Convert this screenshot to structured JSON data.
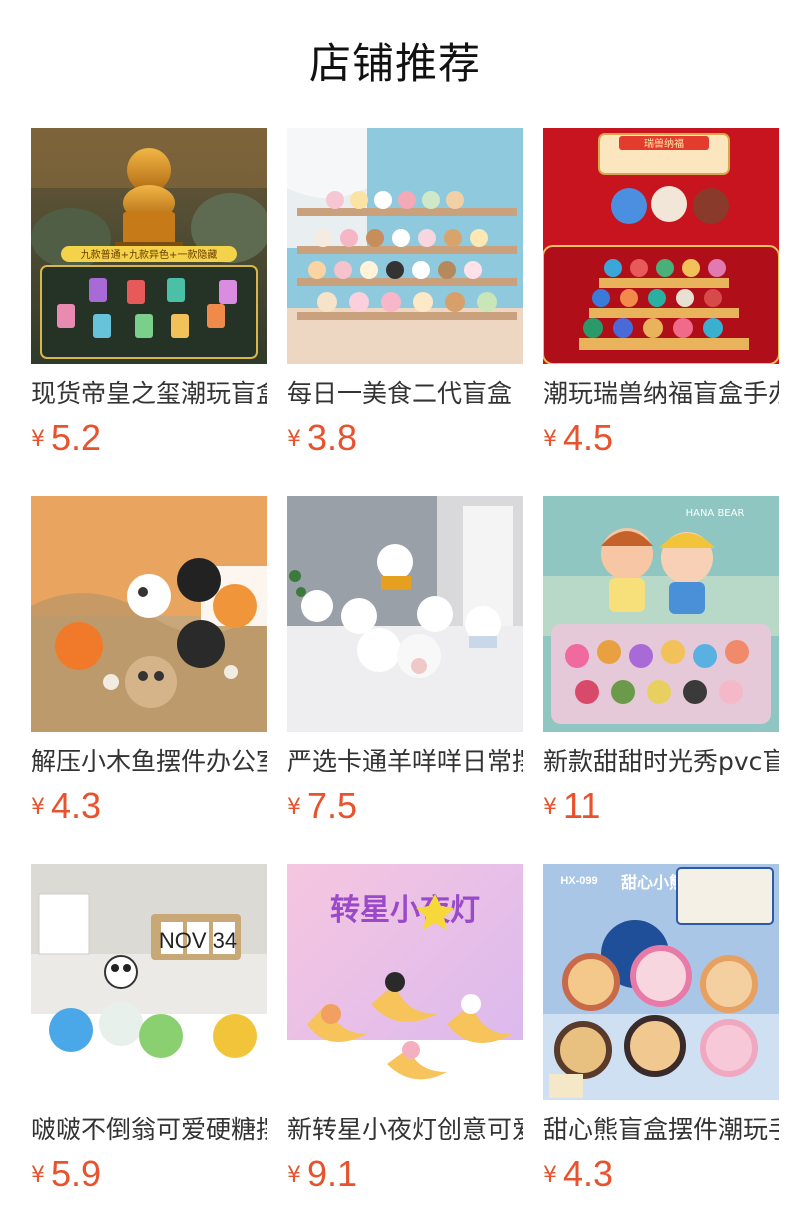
{
  "page": {
    "title": "店铺推荐"
  },
  "currency_symbol": "¥",
  "products": [
    {
      "name": "现货帝皇之玺潮玩盲盒",
      "price": "5.2",
      "image": "dragon-seal-figure",
      "banner_text": "九款普通+九款异色+一款隐藏"
    },
    {
      "name": "每日一美食二代盲盒",
      "price": "3.8",
      "image": "food-figures-shelf"
    },
    {
      "name": "潮玩瑞兽纳福盲盒手办",
      "price": "4.5",
      "image": "lucky-beast-figures",
      "banner_text": "瑞兽纳福"
    },
    {
      "name": "解压小木鱼摆件办公室",
      "price": "4.3",
      "image": "wooden-fish-cats"
    },
    {
      "name": "严选卡通羊咩咩日常摆件",
      "price": "7.5",
      "image": "sheep-figures"
    },
    {
      "name": "新款甜甜时光秀pvc盲盒",
      "price": "11",
      "image": "sweet-time-dolls",
      "banner_text": "HANA BEAR"
    },
    {
      "name": "啵啵不倒翁可爱硬糖摆件",
      "price": "5.9",
      "image": "tumbler-dolls",
      "calendar_text": "NOV 34"
    },
    {
      "name": "新转星小夜灯创意可爱",
      "price": "9.1",
      "image": "moon-night-light",
      "banner_text": "转星小夜灯"
    },
    {
      "name": "甜心熊盲盒摆件潮玩手办",
      "price": "4.3",
      "image": "sweetheart-bears",
      "banner_text": "甜心小熊",
      "tag_text": "HX-099"
    }
  ],
  "colors": {
    "price": "#e8522d",
    "title": "#111111",
    "name": "#333333"
  }
}
